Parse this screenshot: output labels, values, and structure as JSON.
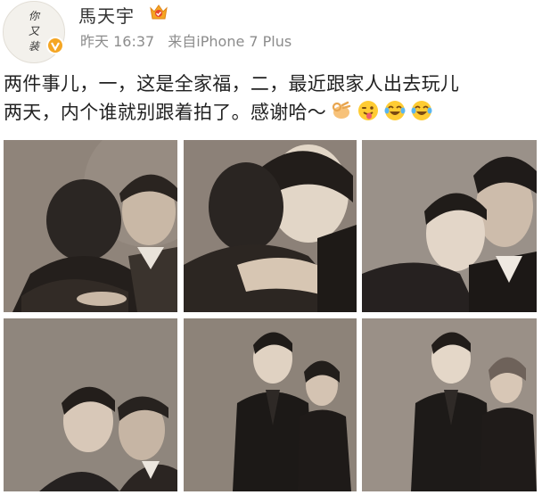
{
  "post": {
    "avatar_text": "你\n又\n装",
    "username": "馬天宇",
    "time": "昨天 16:37",
    "source": "来自iPhone 7 Plus",
    "text_line1": "两件事儿，一，这是全家福，二，最近跟家人出去玩儿",
    "text_line2": "两天，内个谁就别跟着拍了。感谢哈～",
    "emojis": [
      "ok-hand-emoji",
      "tongue-wink-emoji",
      "laugh-tears-emoji",
      "laugh-tears-emoji"
    ]
  },
  "colors": {
    "username": "#333333",
    "meta": "#8c8c8c",
    "verified": "#f5a623",
    "photo_tone": "#8a7e72"
  },
  "photos": [
    "photo-hug-father-back",
    "photo-hug-smile",
    "photo-pose-with-father",
    "photo-forehead-touch-father",
    "photo-standing-with-mother",
    "photo-standing-with-mother-2"
  ]
}
